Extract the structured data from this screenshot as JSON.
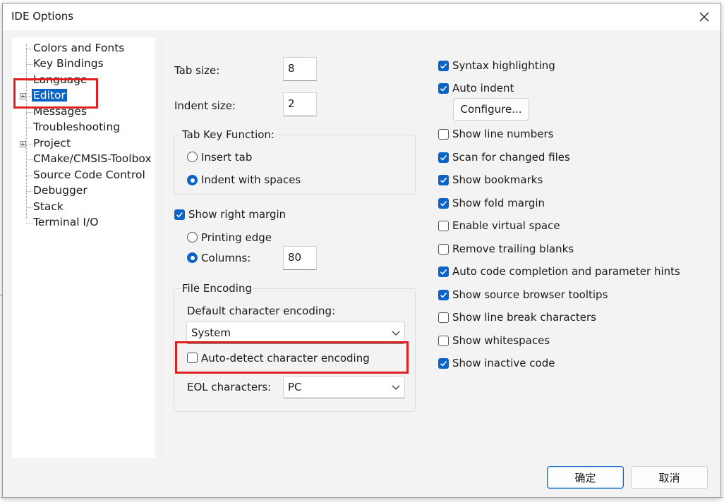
{
  "window": {
    "title": "IDE Options"
  },
  "tree": {
    "items": [
      {
        "label": "Colors and Fonts"
      },
      {
        "label": "Key Bindings"
      },
      {
        "label": "Language"
      },
      {
        "label": "Editor"
      },
      {
        "label": "Messages"
      },
      {
        "label": "Troubleshooting"
      },
      {
        "label": "Project"
      },
      {
        "label": "CMake/CMSIS-Toolbox"
      },
      {
        "label": "Source Code Control"
      },
      {
        "label": "Debugger"
      },
      {
        "label": "Stack"
      },
      {
        "label": "Terminal I/O"
      }
    ],
    "selected": "Editor"
  },
  "editor": {
    "tab_size_label": "Tab size:",
    "tab_size_value": "8",
    "indent_size_label": "Indent size:",
    "indent_size_value": "2",
    "tab_key_group": "Tab Key Function:",
    "insert_tab": "Insert tab",
    "indent_with_spaces": "Indent with spaces",
    "show_right_margin": "Show right margin",
    "printing_edge": "Printing edge",
    "columns_label": "Columns:",
    "columns_value": "80",
    "file_encoding_group": "File Encoding",
    "default_encoding_label": "Default character encoding:",
    "default_encoding_value": "System",
    "auto_detect": "Auto-detect character encoding",
    "eol_label": "EOL characters:",
    "eol_value": "PC",
    "configure_button": "Configure..."
  },
  "options": [
    {
      "label": "Syntax highlighting",
      "checked": true
    },
    {
      "label": "Auto indent",
      "checked": true
    },
    {
      "label": "Show line numbers",
      "checked": false
    },
    {
      "label": "Scan for changed files",
      "checked": true
    },
    {
      "label": "Show bookmarks",
      "checked": true
    },
    {
      "label": "Show fold margin",
      "checked": true
    },
    {
      "label": "Enable virtual space",
      "checked": false
    },
    {
      "label": "Remove trailing blanks",
      "checked": false
    },
    {
      "label": "Auto code completion and parameter hints",
      "checked": true
    },
    {
      "label": "Show source browser tooltips",
      "checked": true
    },
    {
      "label": "Show line break characters",
      "checked": false
    },
    {
      "label": "Show whitespaces",
      "checked": false
    },
    {
      "label": "Show inactive code",
      "checked": true
    }
  ],
  "state": {
    "insert_tab_selected": false,
    "indent_with_spaces_selected": true,
    "show_right_margin_checked": true,
    "printing_edge_selected": false,
    "columns_selected": true,
    "auto_detect_checked": false
  },
  "footer": {
    "ok": "确定",
    "cancel": "取消"
  },
  "colors": {
    "accent": "#0a64c8",
    "highlight_box": "#e02020",
    "background_code": "#2c8f2c"
  }
}
